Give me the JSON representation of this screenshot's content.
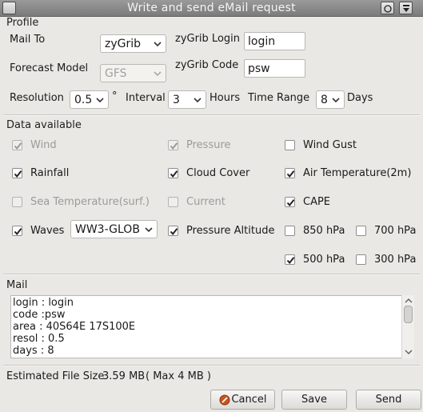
{
  "window": {
    "title": "Write and send eMail request"
  },
  "profile": {
    "section_label": "Profile",
    "mail_to_label": "Mail To",
    "mail_to_value": "zyGrib",
    "login_label": "zyGrib Login",
    "login_value": "login",
    "forecast_model_label": "Forecast Model",
    "forecast_model_value": "GFS",
    "code_label": "zyGrib Code",
    "code_value": "psw",
    "resolution_label": "Resolution",
    "resolution_value": "0.5",
    "degree_symbol": "°",
    "interval_label": "Interval",
    "interval_value": "3",
    "hours_label": "Hours",
    "time_range_label": "Time Range",
    "time_range_value": "8",
    "days_label": "Days"
  },
  "data_available": {
    "section_label": "Data available",
    "items": [
      {
        "label": "Wind",
        "checked": true,
        "disabled": true
      },
      {
        "label": "Pressure",
        "checked": true,
        "disabled": true
      },
      {
        "label": "Wind Gust",
        "checked": false,
        "disabled": false
      },
      {
        "label": "Rainfall",
        "checked": true,
        "disabled": false
      },
      {
        "label": "Cloud Cover",
        "checked": true,
        "disabled": false
      },
      {
        "label": "Air Temperature(2m)",
        "checked": true,
        "disabled": false
      },
      {
        "label": "Sea Temperature(surf.)",
        "checked": false,
        "disabled": true
      },
      {
        "label": "Current",
        "checked": false,
        "disabled": true
      },
      {
        "label": "CAPE",
        "checked": true,
        "disabled": false
      },
      {
        "label": "Waves",
        "checked": true,
        "disabled": false
      },
      {
        "label": "Pressure Altitude",
        "checked": true,
        "disabled": false
      },
      {
        "label": "850 hPa",
        "checked": false,
        "disabled": false
      },
      {
        "label": "700 hPa",
        "checked": false,
        "disabled": false
      },
      {
        "label": "500 hPa",
        "checked": true,
        "disabled": false
      },
      {
        "label": "300 hPa",
        "checked": false,
        "disabled": false
      }
    ],
    "waves_model_value": "WW3-GLOB"
  },
  "mail": {
    "section_label": "Mail",
    "lines": [
      "login : login",
      "code :psw",
      "area : 40S64E 17S100E",
      "resol : 0.5",
      "days : 8"
    ]
  },
  "footer": {
    "estimated_label": "Estimated File Size",
    "estimated_value": "3.59 MB",
    "max_note": "( Max 4 MB )",
    "cancel_label": "Cancel",
    "save_label": "Save",
    "send_label": "Send"
  },
  "colors": {
    "titlebar": "#8a8a8a",
    "background": "#e9e8e4",
    "cancel_icon": "#c9541f"
  },
  "icons": {
    "cancel": "cancel-icon",
    "check": "check-icon",
    "dropdown": "chevron-down-icon"
  }
}
